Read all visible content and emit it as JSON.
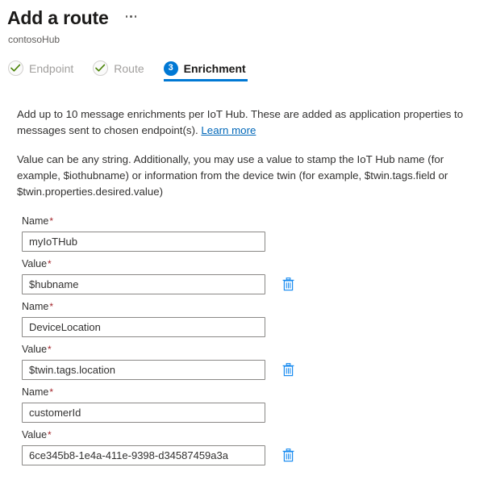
{
  "header": {
    "title": "Add a route",
    "subtitle": "contosoHub",
    "more_menu": "more-options"
  },
  "tabs": [
    {
      "label": "Endpoint",
      "state": "completed",
      "icon": "check-circle-icon"
    },
    {
      "label": "Route",
      "state": "completed",
      "icon": "check-circle-icon"
    },
    {
      "label": "Enrichment",
      "state": "active",
      "number": "3"
    }
  ],
  "description": {
    "paragraph1_before_link": "Add up to 10 message enrichments per IoT Hub. These are added as application properties to messages sent to chosen endpoint(s). ",
    "link_text": "Learn more",
    "paragraph2": "Value can be any string. Additionally, you may use a value to stamp the IoT Hub name (for example, $iothubname) or information from the device twin (for example, $twin.tags.field or $twin.properties.desired.value)"
  },
  "labels": {
    "name": "Name",
    "value": "Value",
    "required_marker": "*",
    "delete_icon": "trash-icon"
  },
  "enrichments": [
    {
      "name": "myIoTHub",
      "value": "$hubname"
    },
    {
      "name": "DeviceLocation",
      "value": "$twin.tags.location"
    },
    {
      "name": "customerId",
      "value": "6ce345b8-1e4a-411e-9398-d34587459a3a"
    }
  ],
  "colors": {
    "accent": "#0078d4",
    "link": "#0067b8",
    "required": "#a4262c",
    "check": "#498205",
    "disabled_text": "#a19f9d"
  }
}
